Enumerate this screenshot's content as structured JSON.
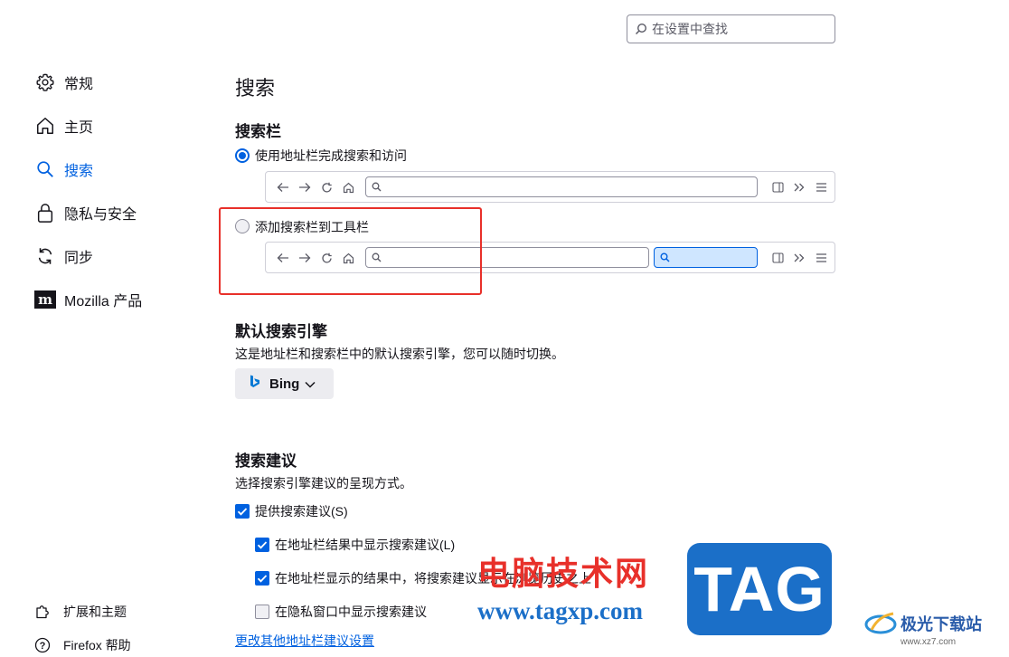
{
  "search_box": {
    "placeholder": "在设置中查找",
    "icon": "search-icon"
  },
  "sidebar": {
    "items": [
      {
        "label": "常规",
        "icon": "gear-icon"
      },
      {
        "label": "主页",
        "icon": "home-icon"
      },
      {
        "label": "搜索",
        "icon": "search-icon",
        "active": true
      },
      {
        "label": "隐私与安全",
        "icon": "lock-icon"
      },
      {
        "label": "同步",
        "icon": "sync-icon"
      },
      {
        "label": "Mozilla 产品",
        "icon": "mozilla-icon"
      }
    ],
    "footer": [
      {
        "label": "扩展和主题",
        "icon": "puzzle-icon"
      },
      {
        "label": "Firefox 帮助",
        "icon": "help-icon"
      }
    ]
  },
  "main": {
    "title": "搜索",
    "searchbar_section": {
      "heading": "搜索栏",
      "option_urlbar": "使用地址栏完成搜索和访问",
      "option_toolbar": "添加搜索栏到工具栏",
      "selected": "option_urlbar"
    },
    "default_engine": {
      "heading": "默认搜索引擎",
      "description": "这是地址栏和搜索栏中的默认搜索引擎，您可以随时切换。",
      "engine": "Bing"
    },
    "suggestions": {
      "heading": "搜索建议",
      "description": "选择搜索引擎建议的呈现方式。",
      "checkboxes": [
        {
          "label": "提供搜索建议(S)",
          "checked": true
        },
        {
          "label": "在地址栏结果中显示搜索建议(L)",
          "checked": true
        },
        {
          "label": "在地址栏显示的结果中，将搜索建议显示在浏览历史之上",
          "checked": true
        },
        {
          "label": "在隐私窗口中显示搜索建议",
          "checked": false
        }
      ],
      "link": "更改其他地址栏建议设置"
    }
  },
  "colors": {
    "accent": "#0061e0",
    "highlight_box": "#e8302a"
  },
  "watermark": {
    "cn_text": "电脑技术网",
    "url": "www.tagxp.com",
    "tag": "TAG",
    "site_name": "极光下载站",
    "site_url": "www.xz7.com"
  }
}
